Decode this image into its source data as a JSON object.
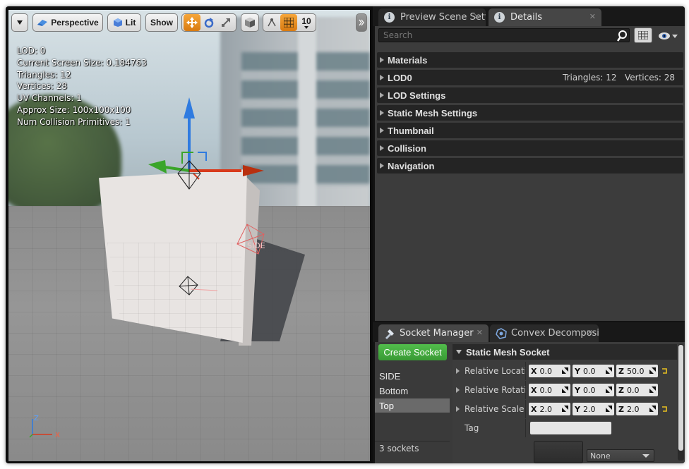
{
  "viewport": {
    "toolbar": {
      "perspective_label": "Perspective",
      "lit_label": "Lit",
      "show_label": "Show",
      "grid_snap_value": "10"
    },
    "stats": [
      "LOD: 0",
      "Current Screen Size: 0.184763",
      "Triangles: 12",
      "Vertices: 28",
      "UV Channels: 1",
      "Approx Size: 100x100x100",
      "Num Collision Primitives: 1"
    ],
    "socket_label": "SIDE",
    "axis": {
      "z": "Z",
      "x": "X"
    }
  },
  "details_tabs": [
    {
      "label": "Preview Scene Setti",
      "icon": "info-icon"
    },
    {
      "label": "Details",
      "icon": "info-icon"
    }
  ],
  "details": {
    "search_placeholder": "Search",
    "categories": [
      {
        "label": "Materials"
      },
      {
        "label": "LOD0",
        "right": "Triangles: 12   Vertices: 28"
      },
      {
        "label": "LOD Settings"
      },
      {
        "label": "Static Mesh Settings"
      },
      {
        "label": "Thumbnail"
      },
      {
        "label": "Collision"
      },
      {
        "label": "Navigation"
      }
    ]
  },
  "bottom_tabs": [
    {
      "label": "Socket Manager",
      "icon": "socket-icon"
    },
    {
      "label": "Convex Decomposi",
      "icon": "convex-icon"
    }
  ],
  "socket_manager": {
    "create_label": "Create Socket",
    "sockets": [
      "SIDE",
      "Bottom",
      "Top"
    ],
    "selected": "Top",
    "count_label": "3 sockets"
  },
  "socket_props": {
    "header": "Static Mesh Socket",
    "rows": [
      {
        "label": "Relative Location",
        "x": "0.0",
        "y": "0.0",
        "z": "50.0",
        "reset": true
      },
      {
        "label": "Relative Rotation",
        "x": "0.0",
        "y": "0.0",
        "z": "0.0",
        "reset": false
      },
      {
        "label": "Relative Scale",
        "x": "2.0",
        "y": "2.0",
        "z": "2.0",
        "reset": true
      }
    ],
    "tag_label": "Tag",
    "tag_value": "",
    "preview_mesh_value": "None"
  },
  "colors": {
    "accent_orange": "#e8901e",
    "create_green": "#46ab40",
    "axis_x": "#d83a1c",
    "axis_y": "#3aa52a",
    "axis_z": "#2f7be0"
  }
}
